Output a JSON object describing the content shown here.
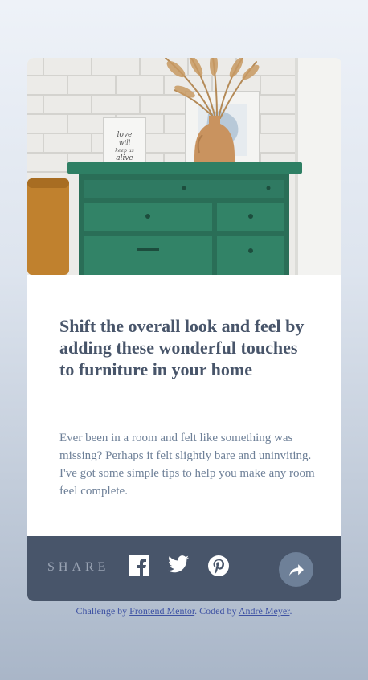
{
  "card": {
    "image": {
      "alt": "drawers",
      "frame_text_lines": [
        "love",
        "will",
        "keep us",
        "alive"
      ]
    },
    "title": "Shift the overall look and feel by adding these wonderful touches to furniture in your home",
    "description": "Ever been in a room and felt like something was missing? Perhaps it felt slightly bare and uninviting. I've got some simple tips to help you make any room feel complete."
  },
  "share_bar": {
    "label": "SHARE",
    "icons": [
      "facebook-icon",
      "twitter-icon",
      "pinterest-icon"
    ],
    "share_button_icon": "share-arrow-icon"
  },
  "attribution": {
    "prefix": "Challenge by ",
    "challenge_link": "Frontend Mentor",
    "middle": ". Coded by ",
    "author_link": "André Meyer",
    "suffix": "."
  },
  "colors": {
    "dark_grayish_blue": "#48556a",
    "desaturated_dark_blue": "#6e8098",
    "grayish_blue": "#9aa4b4",
    "light_grayish_blue": "#ecf2f8",
    "attribution": "#3e52a3",
    "drawer_green": "#2f7a62"
  }
}
